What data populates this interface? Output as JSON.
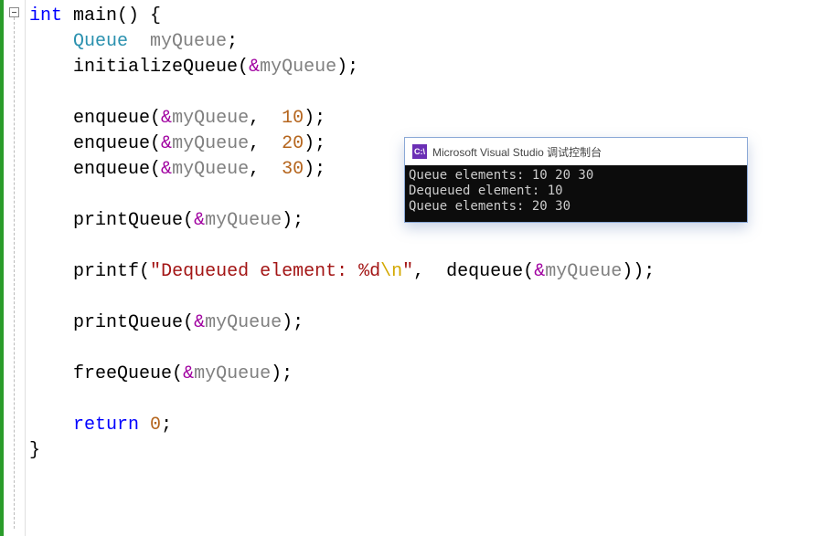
{
  "fold": {
    "symbol": "−"
  },
  "code": {
    "l1": {
      "kw": "int",
      "fn": "main",
      "p": "() {"
    },
    "l2": {
      "indent": "    ",
      "type": "Queue",
      "sp": "  ",
      "var": "myQueue",
      "semi": ";"
    },
    "l3": {
      "indent": "    ",
      "fn": "initializeQueue",
      "open": "(",
      "amp": "&",
      "var": "myQueue",
      "close": ");"
    },
    "l4": {
      "indent": "    ",
      "fn": "enqueue",
      "open": "(",
      "amp": "&",
      "var": "myQueue",
      "comma": ",  ",
      "num": "10",
      "close": ");"
    },
    "l5": {
      "indent": "    ",
      "fn": "enqueue",
      "open": "(",
      "amp": "&",
      "var": "myQueue",
      "comma": ",  ",
      "num": "20",
      "close": ");"
    },
    "l6": {
      "indent": "    ",
      "fn": "enqueue",
      "open": "(",
      "amp": "&",
      "var": "myQueue",
      "comma": ",  ",
      "num": "30",
      "close": ");"
    },
    "l7": {
      "indent": "    ",
      "fn": "printQueue",
      "open": "(",
      "amp": "&",
      "var": "myQueue",
      "close": ");"
    },
    "l8": {
      "indent": "    ",
      "fn": "printf",
      "open": "(",
      "q1": "\"",
      "str": "Dequeued element: %d",
      "esc": "\\n",
      "q2": "\"",
      "comma": ",  ",
      "fn2": "dequeue",
      "open2": "(",
      "amp2": "&",
      "var2": "myQueue",
      "close2": "));"
    },
    "l9": {
      "indent": "    ",
      "fn": "printQueue",
      "open": "(",
      "amp": "&",
      "var": "myQueue",
      "close": ");"
    },
    "l10": {
      "indent": "    ",
      "fn": "freeQueue",
      "open": "(",
      "amp": "&",
      "var": "myQueue",
      "close": ");"
    },
    "l11": {
      "indent": "    ",
      "kw": "return",
      "sp": " ",
      "num": "0",
      "semi": ";"
    },
    "l12": {
      "brace": "}"
    }
  },
  "console": {
    "title": "Microsoft Visual Studio 调试控制台",
    "icon_text": "C:\\",
    "line1": "Queue elements: 10 20 30",
    "line2": "Dequeued element: 10",
    "line3": "Queue elements: 20 30"
  }
}
